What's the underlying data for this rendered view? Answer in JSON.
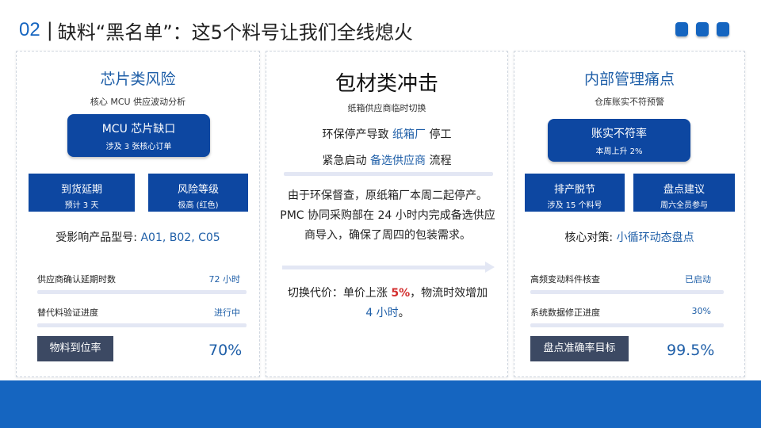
{
  "header": {
    "number": "02",
    "separator": "|",
    "title": "缺料“黑名单”：这5个料号让我们全线熄火"
  },
  "colors": {
    "accent": "#1565c0",
    "dark_box": "#0d47a1",
    "red": "#d32f2f"
  },
  "panel_chip": {
    "title": "芯片类风险",
    "subtitle": "核心 MCU 供应波动分析",
    "badge": {
      "title": "MCU 芯片缺口",
      "sub": "涉及 3 张核心订单"
    },
    "box_left": {
      "title": "到货延期",
      "sub": "预计 3 天"
    },
    "box_right": {
      "title": "风险等级",
      "sub": "极高 (红色)"
    },
    "models_label": "受影响产品型号:",
    "models_value": "A01, B02, C05",
    "row1": {
      "label": "供应商确认延期时数",
      "value": "72 小时"
    },
    "row2": {
      "label": "替代料验证进度",
      "value": "进行中"
    },
    "footer": {
      "label": "物料到位率",
      "value": "70%"
    }
  },
  "panel_pack": {
    "title": "包材类冲击",
    "subtitle": "纸箱供应商临时切换",
    "line1": {
      "pre": "环保停产导致",
      "hl": "纸箱厂",
      "post": "停工"
    },
    "line2": {
      "pre": "紧急启动",
      "hl": "备选供应商",
      "post": "流程"
    },
    "paragraph": "由于环保督查，原纸箱厂本周二起停产。PMC 协同采购部在 24 小时内完成备选供应商导入，确保了周四的包装需求。",
    "cost": {
      "pre": "切换代价：单价上涨 ",
      "red": "5%",
      "mid": "，物流时效增加",
      "blue": "4 小时",
      "post": "。"
    }
  },
  "panel_inventory": {
    "title": "内部管理痛点",
    "subtitle": "仓库账实不符预警",
    "badge": {
      "title": "账实不符率",
      "sub": "本周上升 2%"
    },
    "box_left": {
      "title": "排产脱节",
      "sub": "涉及 15 个料号"
    },
    "box_right": {
      "title": "盘点建议",
      "sub": "周六全员参与"
    },
    "measure_label": "核心对策:",
    "measure_value": "小循环动态盘点",
    "row1": {
      "label": "高频变动料件核查",
      "value": "已启动"
    },
    "row2": {
      "label": "系统数据修正进度",
      "value": "30%"
    },
    "footer": {
      "label": "盘点准确率目标",
      "value": "99.5%"
    }
  }
}
